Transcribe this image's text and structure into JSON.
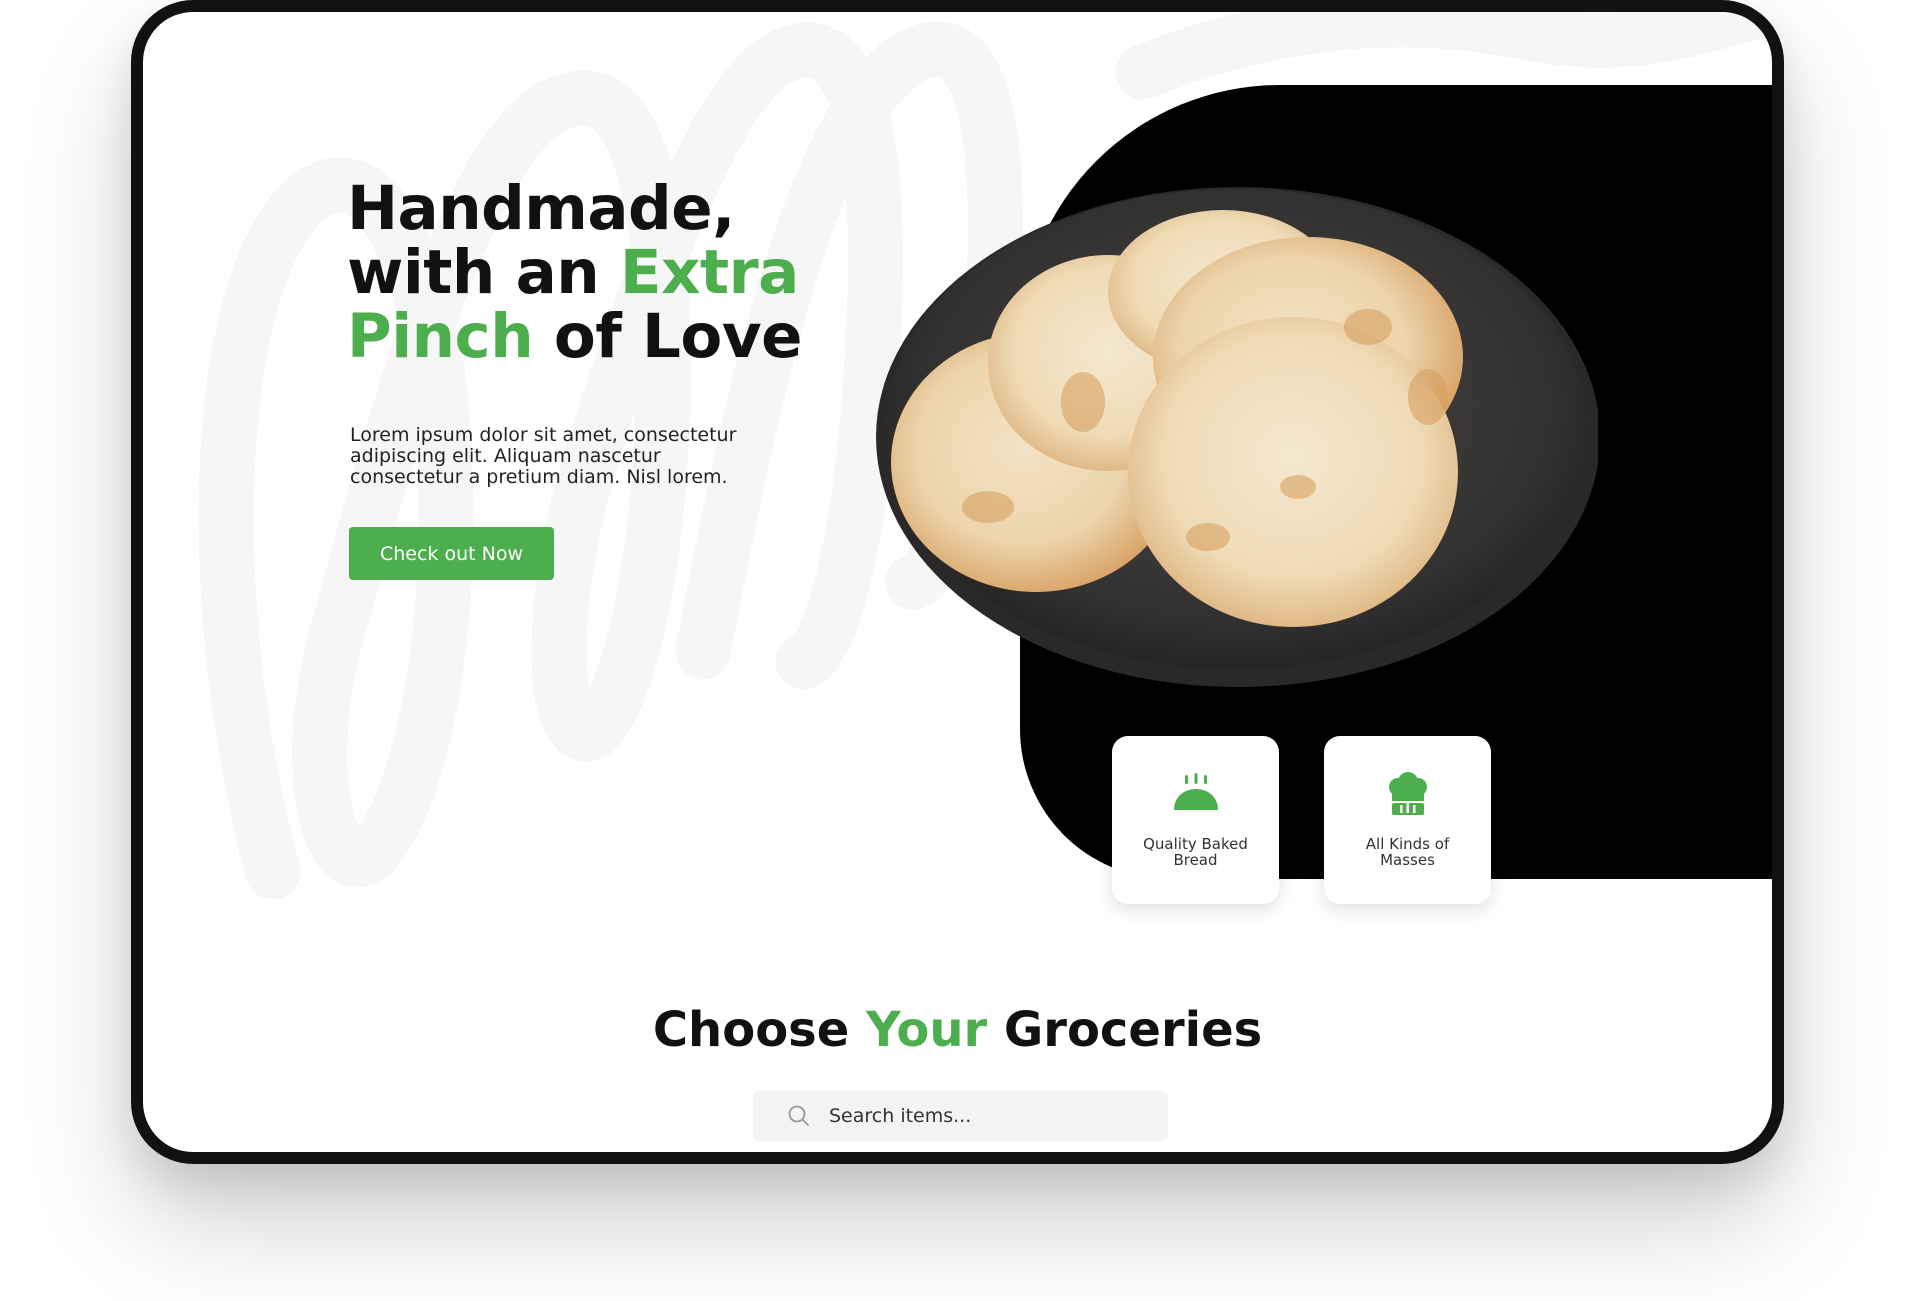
{
  "hero": {
    "title_line1": "Handmade,",
    "title_line2_a": "with an ",
    "title_line2_b": "Extra",
    "title_line3_a": "Pinch",
    "title_line3_b": " of Love",
    "description": "Lorem ipsum dolor sit amet, consectetur adipiscing elit. Aliquam nascetur consectetur a pretium diam. Nisl lorem.",
    "cta_label": "Check out Now"
  },
  "features": [
    {
      "label": "Quality Baked Bread",
      "icon": "bread-icon"
    },
    {
      "label": "All Kinds of Masses",
      "icon": "chef-hat-icon"
    }
  ],
  "groceries": {
    "title_a": "Choose ",
    "title_b": "Your",
    "title_c": " Groceries",
    "search_placeholder": "Search items..."
  },
  "colors": {
    "accent": "#4cae4c",
    "panel": "#000000",
    "text": "#111111"
  }
}
